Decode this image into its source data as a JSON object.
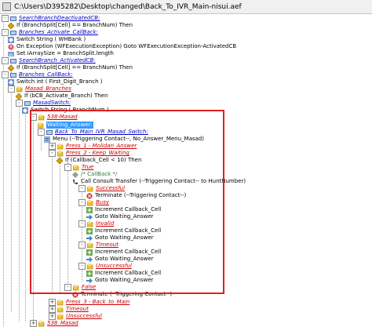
{
  "window": {
    "title": "C:\\Users\\D395282\\Desktop\\changed\\Back_To_IVR_Main-nisui.aef"
  },
  "tree": [
    {
      "text": "SearchBranchDeactivatedCB:",
      "style": "blue"
    },
    {
      "text": "If (BranchSplit[Cell] == BranchNum) Then",
      "style": "kw"
    },
    {
      "text": "Branches_Activate_CallBack:",
      "style": "blue"
    },
    {
      "text": "Switch String ( WHBank )",
      "style": "kw"
    },
    {
      "text": "On Exception (WFExecutionException) Goto WFExecutionException-ActivatedCB",
      "style": "kw"
    },
    {
      "text": "Set iArraySize = BranchSplit.length",
      "style": "kw"
    },
    {
      "text": "SearchBranch_ActivatedCB:",
      "style": "blue"
    },
    {
      "text": "If (BranchSplit[Cell] == BranchNum) Then",
      "style": "kw"
    },
    {
      "text": "Branches_CallBack:",
      "style": "blue"
    },
    {
      "text": "Switch int ( First_Digit_Branch )",
      "style": "kw"
    },
    {
      "text": "Masad_Branches",
      "style": "redi"
    },
    {
      "text": "If (bCB_Activate_Branch) Then",
      "style": "kw"
    },
    {
      "text": "MasadSwitch:",
      "style": "blue"
    },
    {
      "text": "Switch String ( BranchNum )",
      "style": "kw"
    },
    {
      "text": "538-Masad",
      "style": "redi"
    },
    {
      "text": "Waiting_Answer:",
      "style": "sel"
    },
    {
      "text": "Back_To_Main_IVR_Masad_Switch:",
      "style": "blue"
    },
    {
      "text": "Menu (--Triggering Contact--, No_Answer_Menu_Masad)",
      "style": "kw"
    },
    {
      "text": "Press_1 - Molidan_Answer",
      "style": "redi"
    },
    {
      "text": "Press_2 - Keep_Waiting",
      "style": "redi"
    },
    {
      "text": "If (Callback_Cell < 10) Then",
      "style": "kw"
    },
    {
      "text": "True",
      "style": "redi"
    },
    {
      "text": "/* CallBack */",
      "style": "grn"
    },
    {
      "text": "Call Consult Transfer (--Triggering Contact-- to HuntNumber)",
      "style": "kw"
    },
    {
      "text": "Successful",
      "style": "redi"
    },
    {
      "text": "Terminate (--Triggering Contact--)",
      "style": "kw"
    },
    {
      "text": "Busy",
      "style": "redi"
    },
    {
      "text": "Increment Callback_Cell",
      "style": "kw"
    },
    {
      "text": "Goto Waiting_Answer",
      "style": "kw"
    },
    {
      "text": "Invalid",
      "style": "redi"
    },
    {
      "text": "Increment Callback_Cell",
      "style": "kw"
    },
    {
      "text": "Goto Waiting_Answer",
      "style": "kw"
    },
    {
      "text": "Timeout",
      "style": "redi"
    },
    {
      "text": "Increment Callback_Cell",
      "style": "kw"
    },
    {
      "text": "Goto Waiting_Answer",
      "style": "kw"
    },
    {
      "text": "Unsuccessful",
      "style": "redi"
    },
    {
      "text": "Increment Callback_Cell",
      "style": "kw"
    },
    {
      "text": "Goto Waiting_Answer",
      "style": "kw"
    },
    {
      "text": "False",
      "style": "redi"
    },
    {
      "text": "Terminate (--Triggering Contact--)",
      "style": "kw"
    },
    {
      "text": "Press_3 - Back_to_Main",
      "style": "redi"
    },
    {
      "text": "Timeout",
      "style": "redi"
    },
    {
      "text": "Unsuccessful",
      "style": "redi"
    },
    {
      "text": "538_Masad",
      "style": "redi"
    }
  ]
}
